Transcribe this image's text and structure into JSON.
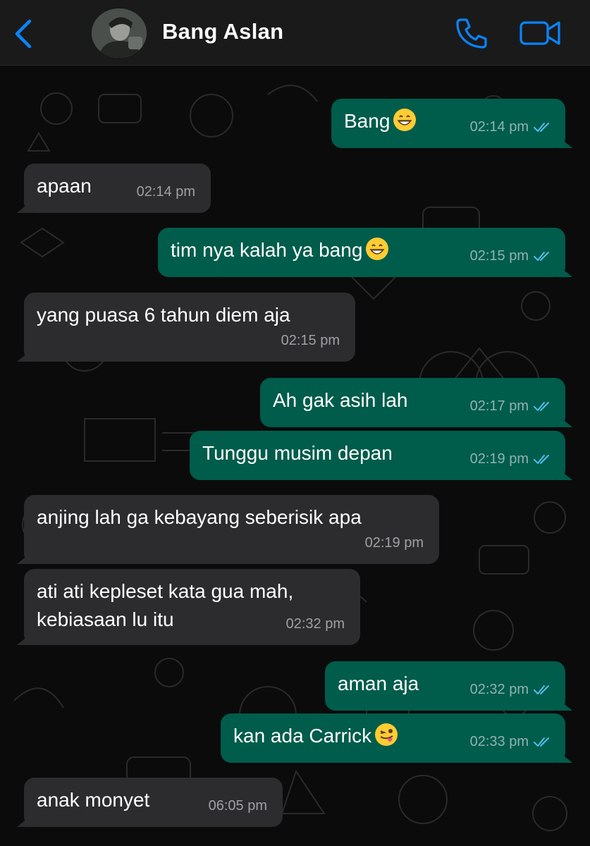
{
  "header": {
    "contact_name": "Bang Aslan",
    "back_icon": "chevron-left-icon",
    "call_icon": "phone-icon",
    "video_icon": "video-camera-icon",
    "accent_color": "#0a84ff"
  },
  "colors": {
    "incoming_bubble": "#2c2c2e",
    "outgoing_bubble": "#005c4b",
    "read_ticks": "#53bdeb"
  },
  "messages": [
    {
      "direction": "out",
      "text": "Bang",
      "emoji": "grinning-face",
      "time": "02:14 pm",
      "status": "read"
    },
    {
      "direction": "in",
      "text": "apaan",
      "time": "02:14 pm"
    },
    {
      "direction": "out",
      "text": "tim nya kalah ya bang",
      "emoji": "grinning-face",
      "time": "02:15 pm",
      "status": "read"
    },
    {
      "direction": "in",
      "text": "yang puasa 6 tahun diem aja",
      "time": "02:15 pm"
    },
    {
      "direction": "out",
      "text": "Ah gak asih lah",
      "time": "02:17 pm",
      "status": "read"
    },
    {
      "direction": "out",
      "text": "Tunggu musim depan",
      "time": "02:19 pm",
      "status": "read"
    },
    {
      "direction": "in",
      "text": "anjing lah ga kebayang seberisik apa",
      "time": "02:19 pm"
    },
    {
      "direction": "in",
      "lines": [
        "ati ati kepleset kata gua mah,",
        "kebiasaan lu itu"
      ],
      "time": "02:32 pm"
    },
    {
      "direction": "out",
      "text": "aman aja",
      "time": "02:32 pm",
      "status": "read"
    },
    {
      "direction": "out",
      "text": "kan ada Carrick",
      "emoji": "winking-face-with-tongue",
      "time": "02:33 pm",
      "status": "read"
    },
    {
      "direction": "in",
      "text": "anak monyet",
      "time": "06:05 pm"
    }
  ]
}
